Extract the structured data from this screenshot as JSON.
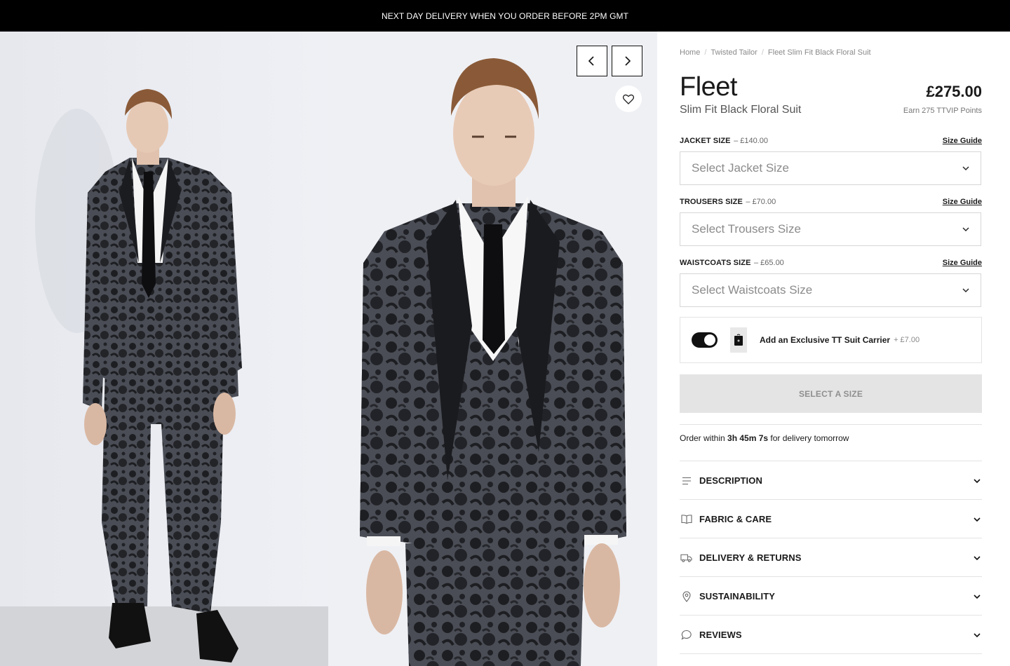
{
  "announcement": "NEXT DAY DELIVERY WHEN YOU ORDER BEFORE 2PM GMT",
  "breadcrumb": [
    "Home",
    "Twisted Tailor",
    "Fleet Slim Fit Black Floral Suit"
  ],
  "product": {
    "title": "Fleet",
    "subtitle": "Slim Fit Black Floral Suit",
    "price": "£275.00",
    "points": "Earn 275 TTVIP Points"
  },
  "sizes": [
    {
      "label": "JACKET SIZE",
      "price": "– £140.00",
      "guide": "Size Guide",
      "placeholder": "Select Jacket Size"
    },
    {
      "label": "TROUSERS SIZE",
      "price": "– £70.00",
      "guide": "Size Guide",
      "placeholder": "Select Trousers Size"
    },
    {
      "label": "WAISTCOATS SIZE",
      "price": "– £65.00",
      "guide": "Size Guide",
      "placeholder": "Select Waistcoats Size"
    }
  ],
  "carrier": {
    "label": "Add an Exclusive TT Suit Carrier",
    "price": "+ £7.00"
  },
  "cta": "SELECT A SIZE",
  "delivery": {
    "prefix": "Order within",
    "countdown": "3h 45m 7s",
    "suffix": "for delivery tomorrow"
  },
  "accordions": [
    {
      "label": "DESCRIPTION",
      "icon": "list-icon"
    },
    {
      "label": "FABRIC & CARE",
      "icon": "book-icon"
    },
    {
      "label": "DELIVERY & RETURNS",
      "icon": "truck-icon"
    },
    {
      "label": "SUSTAINABILITY",
      "icon": "location-pin-icon"
    },
    {
      "label": "REVIEWS",
      "icon": "chat-icon"
    }
  ],
  "colors": {
    "announce_bg": "#000000",
    "cta_bg": "#e4e4e4",
    "cta_text": "#8f8f8f",
    "suit": "#4a4d55",
    "floral": "#1d1e22"
  }
}
